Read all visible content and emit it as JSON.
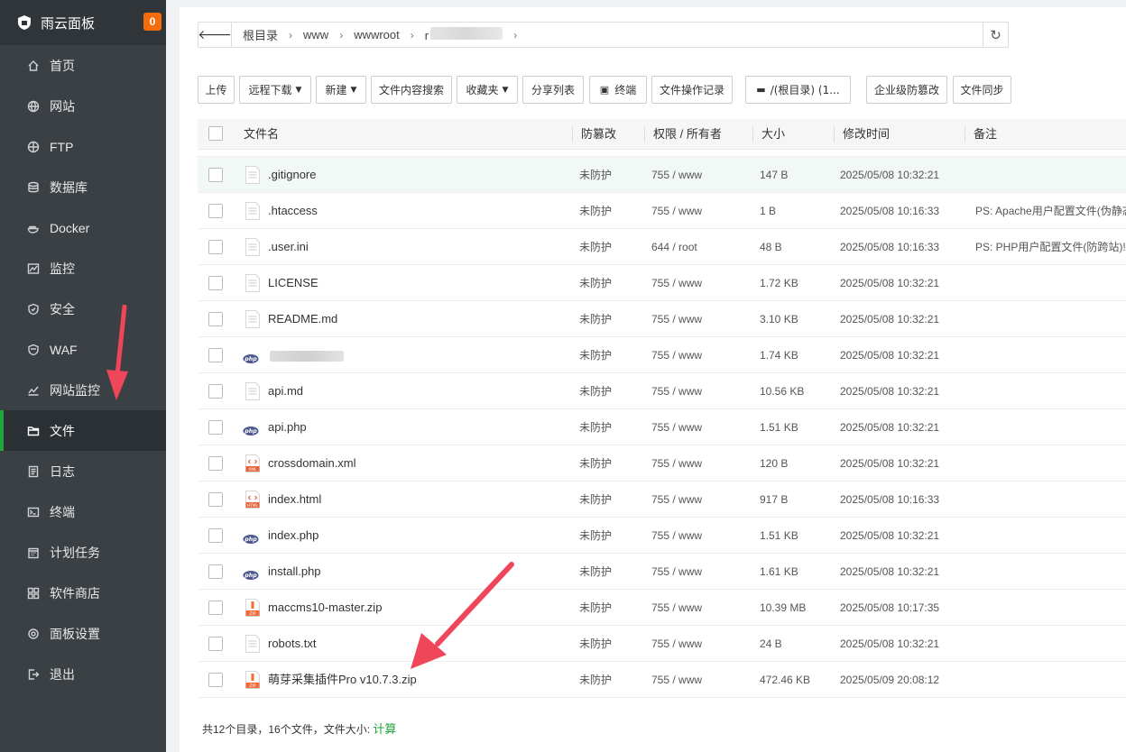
{
  "brand": {
    "name": "雨云面板",
    "badge": "0"
  },
  "sidebar": {
    "items": [
      {
        "label": "首页",
        "icon": "home-icon"
      },
      {
        "label": "网站",
        "icon": "globe-icon"
      },
      {
        "label": "FTP",
        "icon": "ftp-icon"
      },
      {
        "label": "数据库",
        "icon": "database-icon"
      },
      {
        "label": "Docker",
        "icon": "docker-icon"
      },
      {
        "label": "监控",
        "icon": "monitor-chart-icon"
      },
      {
        "label": "安全",
        "icon": "shield-icon"
      },
      {
        "label": "WAF",
        "icon": "waf-shield-icon"
      },
      {
        "label": "网站监控",
        "icon": "site-monitor-icon"
      },
      {
        "label": "文件",
        "icon": "folder-icon",
        "active": true
      },
      {
        "label": "日志",
        "icon": "log-icon"
      },
      {
        "label": "终端",
        "icon": "terminal-icon"
      },
      {
        "label": "计划任务",
        "icon": "calendar-icon"
      },
      {
        "label": "软件商店",
        "icon": "grid-icon"
      },
      {
        "label": "面板设置",
        "icon": "gear-icon"
      },
      {
        "label": "退出",
        "icon": "logout-icon"
      }
    ]
  },
  "path": {
    "crumbs": [
      "根目录",
      "www",
      "wwwroot",
      "r"
    ]
  },
  "toolbar": {
    "upload": "上传",
    "remote_download": "远程下载",
    "new": "新建",
    "content_search": "文件内容搜索",
    "favorites": "收藏夹",
    "share_list": "分享列表",
    "terminal": "终端",
    "op_log": "文件操作记录",
    "disk": "/(根目录) (1...",
    "tamper": "企业级防篡改",
    "sync": "文件同步"
  },
  "table": {
    "headers": {
      "name": "文件名",
      "protect": "防篡改",
      "perm": "权限 / 所有者",
      "size": "大小",
      "mtime": "修改时间",
      "note": "备注"
    },
    "rows": [
      {
        "name": ".gitignore",
        "icon": "file",
        "protect": "未防护",
        "perm": "755 / www",
        "size": "147 B",
        "mtime": "2025/05/08 10:32:21",
        "note": ""
      },
      {
        "name": ".htaccess",
        "icon": "file",
        "protect": "未防护",
        "perm": "755 / www",
        "size": "1 B",
        "mtime": "2025/05/08 10:16:33",
        "note": "PS: Apache用户配置文件(伪静态"
      },
      {
        "name": ".user.ini",
        "icon": "file",
        "protect": "未防护",
        "perm": "644 / root",
        "size": "48 B",
        "mtime": "2025/05/08 10:16:33",
        "note": "PS: PHP用户配置文件(防跨站)!"
      },
      {
        "name": "LICENSE",
        "icon": "file",
        "protect": "未防护",
        "perm": "755 / www",
        "size": "1.72 KB",
        "mtime": "2025/05/08 10:32:21",
        "note": ""
      },
      {
        "name": "README.md",
        "icon": "file",
        "protect": "未防护",
        "perm": "755 / www",
        "size": "3.10 KB",
        "mtime": "2025/05/08 10:32:21",
        "note": ""
      },
      {
        "name": "",
        "icon": "php",
        "blurred": true,
        "protect": "未防护",
        "perm": "755 / www",
        "size": "1.74 KB",
        "mtime": "2025/05/08 10:32:21",
        "note": ""
      },
      {
        "name": "api.md",
        "icon": "file",
        "protect": "未防护",
        "perm": "755 / www",
        "size": "10.56 KB",
        "mtime": "2025/05/08 10:32:21",
        "note": ""
      },
      {
        "name": "api.php",
        "icon": "php",
        "protect": "未防护",
        "perm": "755 / www",
        "size": "1.51 KB",
        "mtime": "2025/05/08 10:32:21",
        "note": ""
      },
      {
        "name": "crossdomain.xml",
        "icon": "xml",
        "protect": "未防护",
        "perm": "755 / www",
        "size": "120 B",
        "mtime": "2025/05/08 10:32:21",
        "note": ""
      },
      {
        "name": "index.html",
        "icon": "html",
        "protect": "未防护",
        "perm": "755 / www",
        "size": "917 B",
        "mtime": "2025/05/08 10:16:33",
        "note": ""
      },
      {
        "name": "index.php",
        "icon": "php",
        "protect": "未防护",
        "perm": "755 / www",
        "size": "1.51 KB",
        "mtime": "2025/05/08 10:32:21",
        "note": ""
      },
      {
        "name": "install.php",
        "icon": "php",
        "protect": "未防护",
        "perm": "755 / www",
        "size": "1.61 KB",
        "mtime": "2025/05/08 10:32:21",
        "note": ""
      },
      {
        "name": "maccms10-master.zip",
        "icon": "zip",
        "protect": "未防护",
        "perm": "755 / www",
        "size": "10.39 MB",
        "mtime": "2025/05/08 10:17:35",
        "note": ""
      },
      {
        "name": "robots.txt",
        "icon": "file",
        "protect": "未防护",
        "perm": "755 / www",
        "size": "24 B",
        "mtime": "2025/05/08 10:32:21",
        "note": ""
      },
      {
        "name": "萌芽采集插件Pro v10.7.3.zip",
        "icon": "zip",
        "protect": "未防护",
        "perm": "755 / www",
        "size": "472.46 KB",
        "mtime": "2025/05/09 20:08:12",
        "note": ""
      }
    ]
  },
  "footer": {
    "summary": "共12个目录，16个文件，文件大小:",
    "calc": "计算"
  },
  "colors": {
    "accent": "#20a53a",
    "arrow": "#f0465a",
    "badge": "#f56c0c"
  }
}
